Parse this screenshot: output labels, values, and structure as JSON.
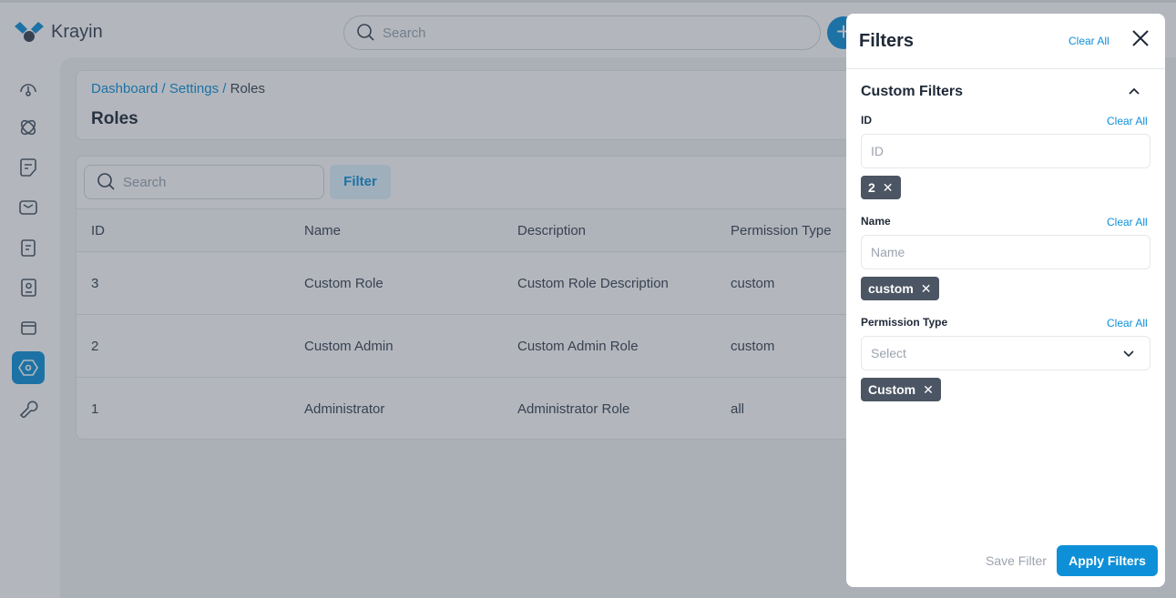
{
  "app": {
    "name": "Krayin",
    "search_placeholder": "Search"
  },
  "sidebar": {
    "items": [
      "dashboard",
      "leads",
      "quotes",
      "mail",
      "activities",
      "contacts",
      "products",
      "settings",
      "configuration"
    ],
    "active": "settings"
  },
  "breadcrumb": {
    "items": [
      "Dashboard",
      "Settings"
    ],
    "current": "Roles"
  },
  "page_title": "Roles",
  "table": {
    "search_placeholder": "Search",
    "filter_label": "Filter",
    "columns": [
      "ID",
      "Name",
      "Description",
      "Permission Type"
    ],
    "rows": [
      [
        "3",
        "Custom Role",
        "Custom Role Description",
        "custom"
      ],
      [
        "2",
        "Custom Admin",
        "Custom Admin Role",
        "custom"
      ],
      [
        "1",
        "Administrator",
        "Administrator Role",
        "all"
      ]
    ]
  },
  "filters": {
    "title": "Filters",
    "clear_all": "Clear All",
    "section": "Custom Filters",
    "fields": [
      {
        "label": "ID",
        "placeholder": "ID",
        "clear": "Clear All",
        "chip": "2"
      },
      {
        "label": "Name",
        "placeholder": "Name",
        "clear": "Clear All",
        "chip": "custom"
      },
      {
        "label": "Permission Type",
        "placeholder": "Select",
        "clear": "Clear All",
        "chip": "Custom"
      }
    ],
    "save_label": "Save Filter",
    "apply_label": "Apply Filters"
  },
  "colors": {
    "accent": "#0e90d9"
  }
}
